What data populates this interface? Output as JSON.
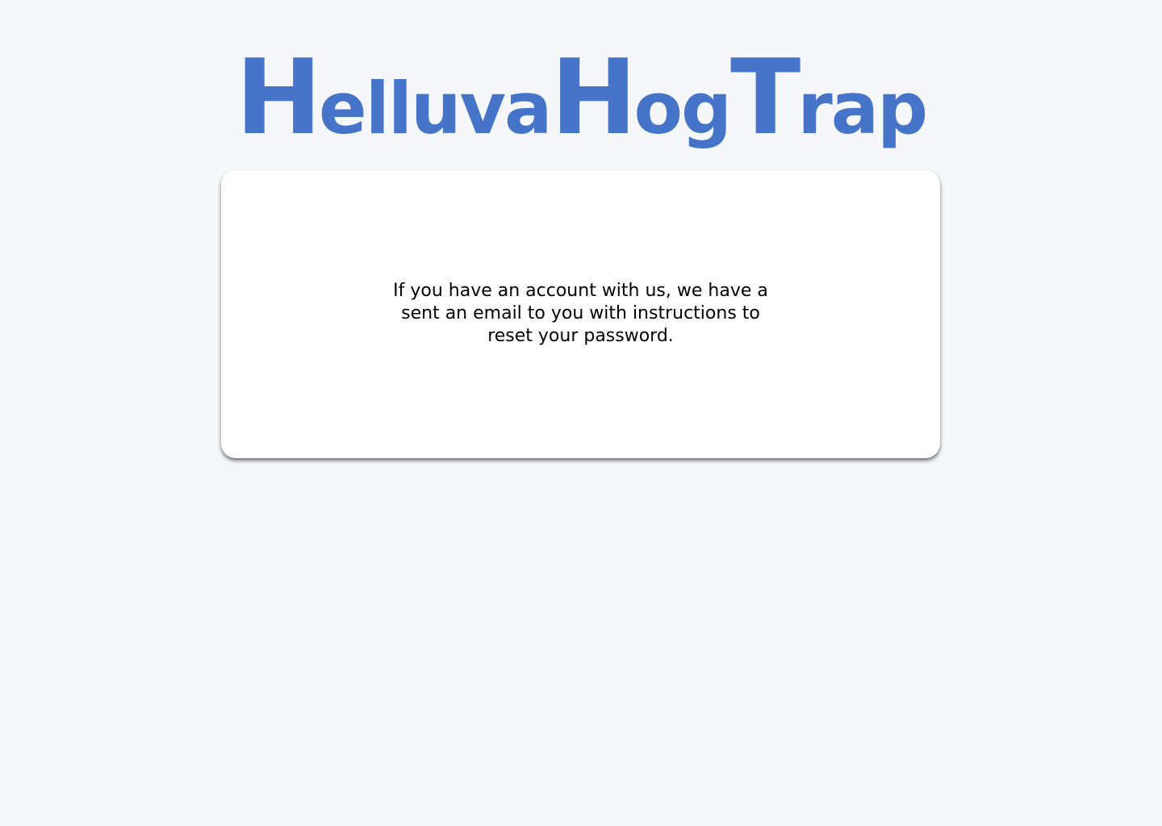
{
  "logo": {
    "text": "HelluvaHogTrap",
    "parts": [
      {
        "cap": "H",
        "rest": "elluva"
      },
      {
        "cap": "H",
        "rest": "og"
      },
      {
        "cap": "T",
        "rest": "rap"
      }
    ],
    "color": "#4674c8"
  },
  "card": {
    "message": "If you have an account with us, we have a sent an email to you with instructions to reset your password."
  },
  "colors": {
    "page_background": "#f6f7fb",
    "card_background": "#ffffff",
    "text": "#000000",
    "brand": "#4674c8"
  }
}
